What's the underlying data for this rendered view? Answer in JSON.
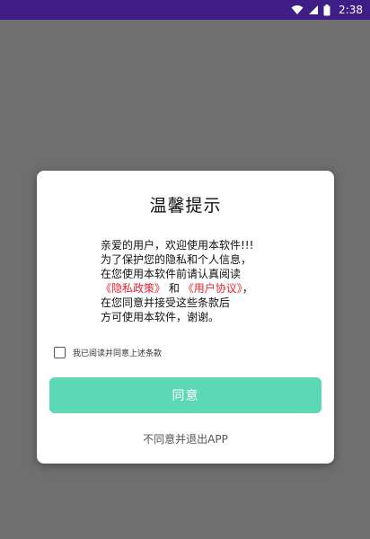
{
  "status_bar": {
    "time": "2:38",
    "icons": [
      "wifi-icon",
      "signal-icon",
      "battery-icon"
    ]
  },
  "dialog": {
    "title": "温馨提示",
    "body_lines": [
      "亲爱的用户，欢迎使用本软件!!!",
      "为了保护您的隐私和个人信息，",
      "在您使用本软件前请认真阅读"
    ],
    "privacy_link": "《隐私政策》",
    "conjunction": "和",
    "agreement_link": "《用户协议》",
    "link_suffix": "，",
    "body_lines_after": [
      "在您同意并接受这些条款后",
      "方可使用本软件，谢谢。"
    ],
    "checkbox_label": "我已阅读并同意上述条款",
    "checkbox_checked": false,
    "agree_button": "同意",
    "exit_link": "不同意并退出APP"
  },
  "colors": {
    "status_bar": "#3f1d86",
    "backdrop": "#6f6f6f",
    "accent_button": "#5dd8b5",
    "link": "#e8232f"
  }
}
